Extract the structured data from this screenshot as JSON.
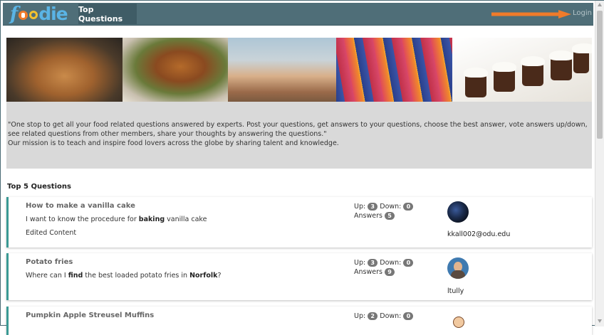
{
  "header": {
    "logo_text": "foodie",
    "nav_tab": "Top Questions",
    "login_label": "Login",
    "accent": "#f07b2a"
  },
  "banner": {
    "images": [
      "roast-chicken",
      "glazed-pork-chop",
      "dessert-table",
      "berries",
      "chocolate-mousse-cups"
    ]
  },
  "mission": {
    "line1": "\"One stop to get all your food related questions answered by experts. Post your questions, get answers to your questions, choose the best answer, vote answers up/down, see related questions from other members, share your thoughts by answering the questions.\"",
    "line2": "Our mission is to teach and inspire food lovers across the globe by sharing talent and knowledge."
  },
  "section": {
    "title": "Top 5 Questions"
  },
  "labels": {
    "up": "Up:",
    "down": "Down:",
    "answers": "Answers"
  },
  "questions": [
    {
      "title": "How to make a vanilla cake",
      "body_pre": "I want to know the procedure for ",
      "body_b1": "baking",
      "body_mid": " vanilla cake",
      "body_b2": "",
      "body_post": "",
      "edited": "Edited Content",
      "up": "3",
      "down": "0",
      "answers": "5",
      "user": "kkall002@odu.edu"
    },
    {
      "title": "Potato fries",
      "body_pre": "Where can I ",
      "body_b1": "find",
      "body_mid": " the best loaded potato fries in ",
      "body_b2": "Norfolk",
      "body_post": "?",
      "edited": "",
      "up": "3",
      "down": "0",
      "answers": "9",
      "user": "ltully"
    },
    {
      "title": "Pumpkin Apple Streusel Muffins",
      "up": "2",
      "down": "0"
    }
  ]
}
